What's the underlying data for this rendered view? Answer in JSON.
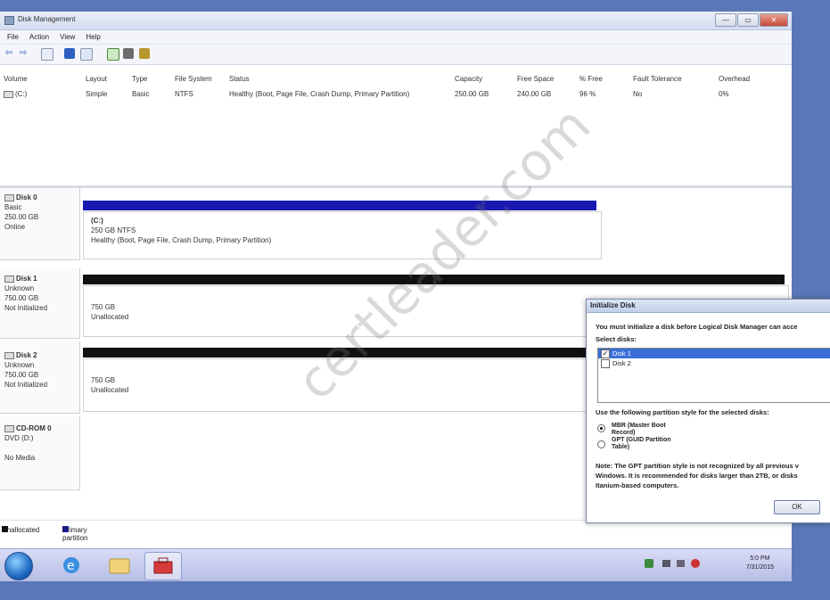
{
  "window": {
    "title": "Disk Management",
    "buttons": {
      "minimize": "—",
      "maximize": "▭",
      "close": "✕"
    }
  },
  "menu": [
    "File",
    "Action",
    "View",
    "Help"
  ],
  "volume_table": {
    "headers": [
      "Volume",
      "Layout",
      "Type",
      "File System",
      "Status",
      "Capacity",
      "Free Space",
      "% Free",
      "Fault Tolerance",
      "Overhead"
    ],
    "rows": [
      [
        "(C:)",
        "Simple",
        "Basic",
        "NTFS",
        "Healthy (Boot, Page File, Crash Dump, Primary Partition)",
        "250.00 GB",
        "240.00 GB",
        "96 %",
        "No",
        "0%"
      ]
    ]
  },
  "disks": [
    {
      "name": "Disk 0",
      "type": "Basic",
      "size": "250.00 GB",
      "state": "Online",
      "partition": {
        "title": "(C:)",
        "detail": "250 GB NTFS",
        "status": "Healthy (Boot, Page File, Crash Dump, Primary Partition)"
      }
    },
    {
      "name": "Disk 1",
      "type": "Unknown",
      "size": "750.00 GB",
      "state": "Not Initialized",
      "partition": {
        "size": "750 GB",
        "status": "Unallocated"
      }
    },
    {
      "name": "Disk 2",
      "type": "Unknown",
      "size": "750.00 GB",
      "state": "Not Initialized",
      "partition": {
        "size": "750 GB",
        "status": "Unallocated"
      }
    },
    {
      "name": "CD-ROM 0",
      "type": "DVD (D:)",
      "state": "No Media"
    }
  ],
  "legend": {
    "unallocated": "Unallocated",
    "primary": "Primary partition"
  },
  "colors": {
    "primary": "#1a1ab0",
    "unallocated": "#111111"
  },
  "taskbar": {
    "time": "5:0 PM",
    "date": "7/31/2015"
  },
  "dialog": {
    "title": "Initialize Disk",
    "intro": "You must initialize a disk before Logical Disk Manager can acce",
    "select_label": "Select disks:",
    "disks": [
      "Disk 1",
      "Disk 2"
    ],
    "style_label": "Use the following partition style for the selected disks:",
    "mbr": "MBR (Master Boot Record)",
    "gpt": "GPT (GUID Partition Table)",
    "note1": "Note: The GPT partition style is not recognized by all previous v",
    "note2": "Windows. It is recommended for disks larger than 2TB, or disks",
    "note3": "Itanium-based computers.",
    "ok": "OK"
  },
  "watermark": "certleader.com"
}
